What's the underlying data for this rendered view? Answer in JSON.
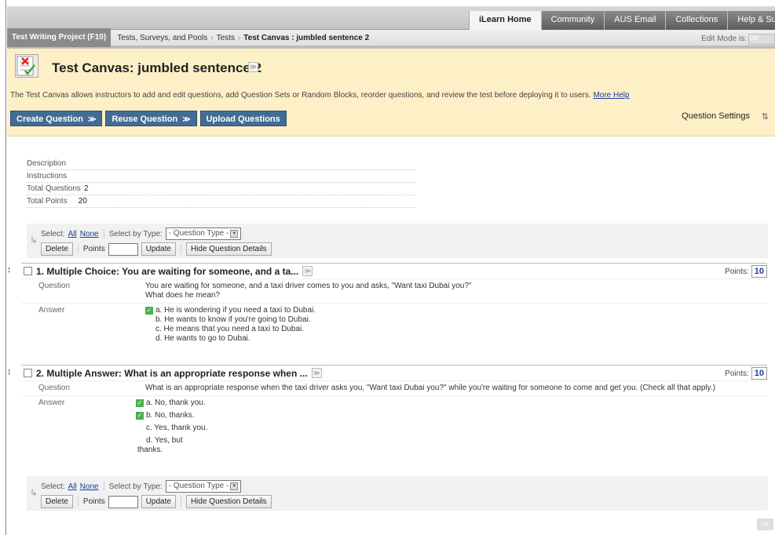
{
  "topnav": {
    "tabs": [
      {
        "label": "iLearn Home",
        "active": true
      },
      {
        "label": "Community",
        "active": false
      },
      {
        "label": "AUS Email",
        "active": false
      },
      {
        "label": "Collections",
        "active": false
      },
      {
        "label": "Help & Suppor",
        "active": false
      }
    ]
  },
  "breadcrumb": {
    "course": "Test Writing Project (F10)",
    "items": [
      "Tests, Surveys, and Pools",
      "Tests",
      "Test Canvas : jumbled sentence 2"
    ],
    "separator": "›",
    "edit_mode_label": "Edit Mode is:",
    "edit_toggle": "ON"
  },
  "page": {
    "title": "Test Canvas: jumbled sentence 2",
    "description": "The Test Canvas allows instructors to add and edit questions, add Question Sets or Random Blocks, reorder questions, and review the test before deploying it to users.",
    "help_link": "More Help",
    "actions": [
      {
        "label": "Create Question",
        "chevron": "≫"
      },
      {
        "label": "Reuse Question",
        "chevron": "≫"
      },
      {
        "label": "Upload Questions",
        "chevron": ""
      }
    ],
    "question_settings": "Question Settings",
    "sort_icon": "⇅"
  },
  "info": {
    "description_label": "Description",
    "instructions_label": "Instructions",
    "total_questions_label": "Total Questions",
    "total_questions": "2",
    "total_points_label": "Total Points",
    "total_points": "20"
  },
  "toolbar": {
    "select_label": "Select:",
    "all": "All",
    "none": "None",
    "select_by_type": "Select by Type:",
    "type_placeholder": "- Question Type -",
    "delete": "Delete",
    "points": "Points",
    "update": "Update",
    "hide_details": "Hide Question Details"
  },
  "questions": [
    {
      "title": "1. Multiple Choice: You are waiting for someone, and a ta...",
      "points_label": "Points:",
      "points": "10",
      "question_label": "Question",
      "question_text_1": "You are waiting for someone, and a taxi driver comes to you and asks, \"Want taxi Dubai you?\"",
      "question_text_2": "What does he mean?",
      "answer_label": "Answer",
      "answers": [
        {
          "text": "a. He is wondering if you need a taxi to Dubai.",
          "correct": true
        },
        {
          "text": "b. He wants to know if you're going to Dubai.",
          "correct": false
        },
        {
          "text": "c. He means that you need a taxi to Dubai.",
          "correct": false
        },
        {
          "text": "d. He wants to go to Dubai.",
          "correct": false
        }
      ]
    },
    {
      "title": "2. Multiple Answer: What is an appropriate response when ...",
      "points_label": "Points:",
      "points": "10",
      "question_label": "Question",
      "question_text_1": "What is an appropriate response when the taxi driver asks you, \"Want taxi Dubai you?\" while you're waiting for someone to come and get you. (Check all that apply.)",
      "question_text_2": "",
      "answer_label": "Answer",
      "answers": [
        {
          "text": "a. No, thank you.",
          "correct": true
        },
        {
          "text": "b. No, thanks.",
          "correct": true
        },
        {
          "text": "c. Yes, thank you.",
          "correct": false
        },
        {
          "text": "d. Yes, but",
          "correct": false
        }
      ],
      "answer_extra": "thanks."
    }
  ],
  "footer": {
    "ok": "OK"
  }
}
